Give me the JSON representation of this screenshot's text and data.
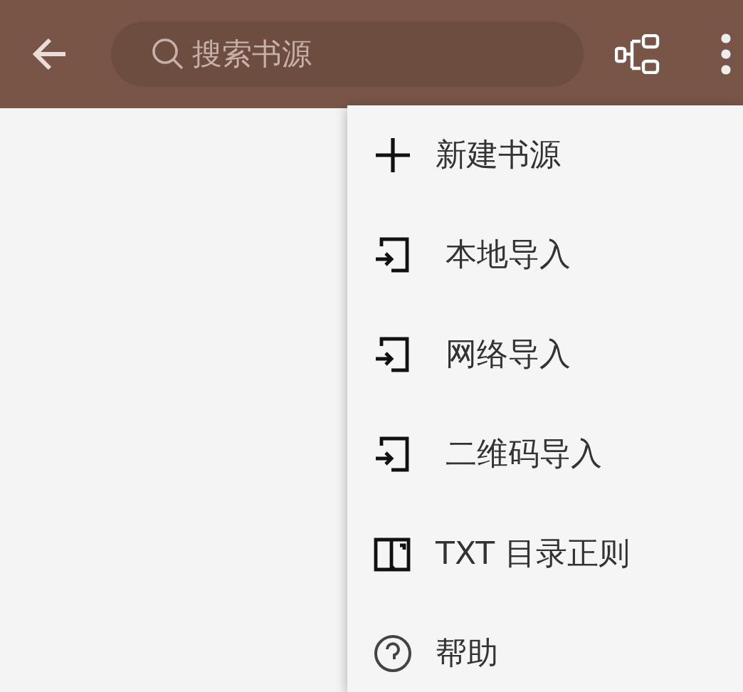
{
  "toolbar": {
    "search": {
      "placeholder": "搜索书源"
    }
  },
  "menu": {
    "items": [
      {
        "kind": "add",
        "label": "新建书源"
      },
      {
        "kind": "import",
        "label": "本地导入"
      },
      {
        "kind": "import",
        "label": "网络导入"
      },
      {
        "kind": "import",
        "label": "二维码导入"
      },
      {
        "kind": "book",
        "label": "TXT 目录正则"
      },
      {
        "kind": "help",
        "label": "帮助"
      }
    ]
  }
}
